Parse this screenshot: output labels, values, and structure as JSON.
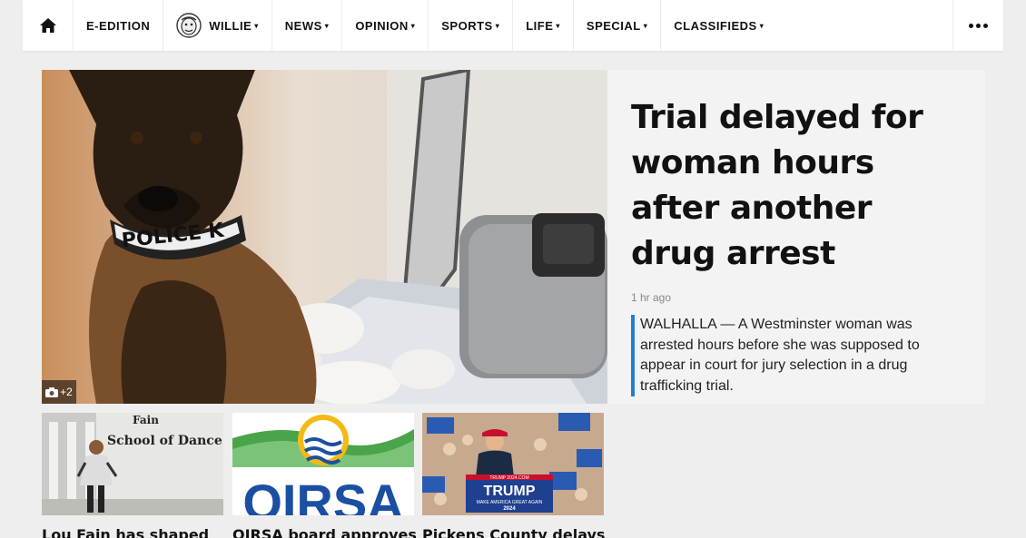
{
  "nav": {
    "items": [
      {
        "label": "E-EDITION",
        "dropdown": false
      },
      {
        "label": "WILLIE",
        "dropdown": true
      },
      {
        "label": "NEWS",
        "dropdown": true
      },
      {
        "label": "OPINION",
        "dropdown": true
      },
      {
        "label": "SPORTS",
        "dropdown": true
      },
      {
        "label": "LIFE",
        "dropdown": true
      },
      {
        "label": "SPECIAL",
        "dropdown": true
      },
      {
        "label": "CLASSIFIEDS",
        "dropdown": true
      }
    ],
    "caret": "▾",
    "home_icon": "home-icon",
    "more_icon": "more-dots-icon"
  },
  "hero": {
    "title": "Trial delayed for woman hours after another drug arrest",
    "time": "1 hr ago",
    "summary": "WALHALLA — A Westminster woman was arrested hours before she was supposed to appear in court for jury selection in a drug trafficking trial.",
    "photo_count": "+2",
    "collar_text": "POLICE K",
    "accent_color": "#1f7fd1"
  },
  "thumbs": [
    {
      "title": "Lou Fain has shaped",
      "sign_line1": "Fain",
      "sign_line2": "School of Dance"
    },
    {
      "title": "OIRSA board approves",
      "logo_text": "OIRSA"
    },
    {
      "title": "Pickens County delays",
      "sign_top": "TRUMP",
      "sign_sub": "MAKE AMERICA GREAT AGAIN",
      "sign_year": "2024",
      "sign_url": "TRUMP 2024.COM"
    }
  ]
}
